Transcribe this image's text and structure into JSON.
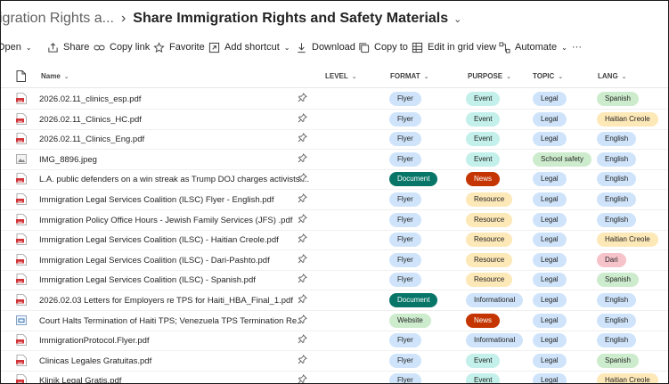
{
  "breadcrumb": {
    "parent": "igration Rights a...",
    "separator": "›",
    "current": "Share Immigration Rights and Safety Materials",
    "chevron": "⌄"
  },
  "commands": [
    {
      "label": "Open",
      "icon": "none",
      "has_chevron": true
    },
    {
      "label": "Share",
      "icon": "share-icon",
      "has_chevron": false
    },
    {
      "label": "Copy link",
      "icon": "link-icon",
      "has_chevron": false
    },
    {
      "label": "Favorite",
      "icon": "star-icon",
      "has_chevron": false
    },
    {
      "label": "Add shortcut",
      "icon": "add-shortcut-icon",
      "has_chevron": true
    },
    {
      "label": "Download",
      "icon": "download-icon",
      "has_chevron": false
    },
    {
      "label": "Copy to",
      "icon": "copy-icon",
      "has_chevron": false
    },
    {
      "label": "Edit in grid view",
      "icon": "grid-icon",
      "has_chevron": false
    },
    {
      "label": "Automate",
      "icon": "automate-icon",
      "has_chevron": true
    },
    {
      "label": "···",
      "icon": "none",
      "has_chevron": false
    }
  ],
  "columns": {
    "name": "Name",
    "level": "LEVEL",
    "format": "FORMAT",
    "purpose": "PURPOSE",
    "topic": "TOPIC",
    "lang": "LANG"
  },
  "colors": {
    "flyer": "#cfe4fa",
    "document": "#077568",
    "website": "#cdeccd",
    "event": "#c3f0ea",
    "news": "#c43501",
    "resource": "#fde8b8",
    "informational": "#cfe4fa",
    "legal": "#cfe4fa",
    "school_safety": "#cdeccd",
    "spanish": "#cdeccd",
    "haitian_creole": "#fde8b8",
    "english": "#cfe4fa",
    "dari": "#f7c3cb"
  },
  "rows": [
    {
      "name": "2026.02.11_clinics_esp.pdf",
      "icon": "pdf-icon",
      "format": "Flyer",
      "purpose": "Event",
      "topic": "Legal",
      "lang": "Spanish"
    },
    {
      "name": "2026.02.11_Clinics_HC.pdf",
      "icon": "pdf-icon",
      "format": "Flyer",
      "purpose": "Event",
      "topic": "Legal",
      "lang": "Haitian Creole"
    },
    {
      "name": "2026.02.11_Clinics_Eng.pdf",
      "icon": "pdf-icon",
      "format": "Flyer",
      "purpose": "Event",
      "topic": "Legal",
      "lang": "English"
    },
    {
      "name": "IMG_8896.jpeg",
      "icon": "image-icon",
      "format": "Flyer",
      "purpose": "Event",
      "topic": "School safety",
      "lang": "English"
    },
    {
      "name": "L.A. public defenders on a win streak as Trump DOJ charges activists....",
      "icon": "pdf-icon",
      "format": "Document",
      "purpose": "News",
      "topic": "Legal",
      "lang": "English"
    },
    {
      "name": "Immigration Legal Services Coalition (ILSC) Flyer - English.pdf",
      "icon": "pdf-icon",
      "format": "Flyer",
      "purpose": "Resource",
      "topic": "Legal",
      "lang": "English"
    },
    {
      "name": "Immigration Policy Office Hours - Jewish Family Services (JFS) .pdf",
      "icon": "pdf-icon",
      "format": "Flyer",
      "purpose": "Resource",
      "topic": "Legal",
      "lang": "English"
    },
    {
      "name": "Immigration Legal Services Coalition (ILSC) - Haitian Creole.pdf",
      "icon": "pdf-icon",
      "format": "Flyer",
      "purpose": "Resource",
      "topic": "Legal",
      "lang": "Haitian Creole"
    },
    {
      "name": "Immigration Legal Services Coalition (ILSC) - Dari-Pashto.pdf",
      "icon": "pdf-icon",
      "format": "Flyer",
      "purpose": "Resource",
      "topic": "Legal",
      "lang": "Dari"
    },
    {
      "name": "Immigration Legal Services Coalition (ILSC) - Spanish.pdf",
      "icon": "pdf-icon",
      "format": "Flyer",
      "purpose": "Resource",
      "topic": "Legal",
      "lang": "Spanish"
    },
    {
      "name": "2026.02.03 Letters for Employers re TPS for Haiti_HBA_Final_1.pdf",
      "icon": "pdf-icon",
      "format": "Document",
      "purpose": "Informational",
      "topic": "Legal",
      "lang": "English"
    },
    {
      "name": "Court Halts Termination of Haiti TPS; Venezuela TPS Termination Re...",
      "icon": "link-file-icon",
      "format": "Website",
      "purpose": "News",
      "topic": "Legal",
      "lang": "English"
    },
    {
      "name": "ImmigrationProtocol.Flyer.pdf",
      "icon": "pdf-icon",
      "format": "Flyer",
      "purpose": "Informational",
      "topic": "Legal",
      "lang": "English"
    },
    {
      "name": "Clinicas Legales Gratuitas.pdf",
      "icon": "pdf-icon",
      "format": "Flyer",
      "purpose": "Event",
      "topic": "Legal",
      "lang": "Spanish"
    },
    {
      "name": "Klinik Legal Gratis.pdf",
      "icon": "pdf-icon",
      "format": "Flyer",
      "purpose": "Event",
      "topic": "Legal",
      "lang": "Haitian Creole"
    }
  ]
}
